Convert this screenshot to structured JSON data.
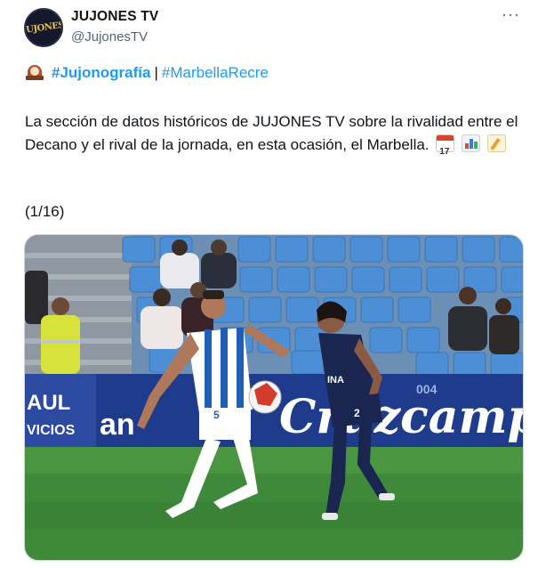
{
  "tweet": {
    "display_name": "JUJONES TV",
    "handle": "@JujonesTV",
    "avatar_text": "JUJONES",
    "more_label": "···",
    "hashtags": {
      "tag1": "#Jujonografía",
      "separator": "|",
      "tag2": "#MarbellaRecre"
    },
    "text_line": "La sección de datos históricos de JUJONES TV sobre la rivalidad entre el Decano y el rival de la jornada, en esta ocasión, el Marbella.",
    "counter": "(1/16)"
  },
  "media": {
    "banner_left_top": "AUL",
    "banner_left_mid": "VICIOS",
    "banner_center": "an",
    "banner_right": "Cruzcamp",
    "banner_year": "004",
    "player1_number": "5",
    "player2_chest": "INA",
    "player2_number": "2"
  },
  "colors": {
    "link": "#1d9bf0",
    "secondary_text": "#536471",
    "pitch": "#3e8a3a",
    "seats": "#4d8fd6",
    "banner": "#1f3b8c"
  },
  "icons": [
    "mantel-clock-icon",
    "calendar-icon",
    "bar-chart-icon",
    "memo-icon",
    "more-icon"
  ]
}
